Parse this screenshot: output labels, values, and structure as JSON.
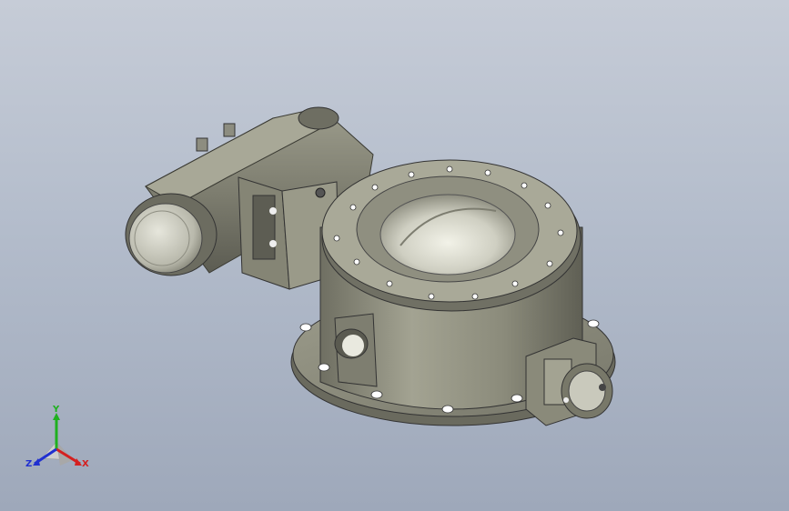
{
  "viewport": {
    "background_top": "#c6ccd7",
    "background_bottom": "#9ea8ba",
    "model_color": "#8a8a7a"
  },
  "triad": {
    "x_label": "X",
    "y_label": "Y",
    "z_label": "Z",
    "x_color": "#d42020",
    "y_color": "#1fb01f",
    "z_color": "#2030d0"
  }
}
